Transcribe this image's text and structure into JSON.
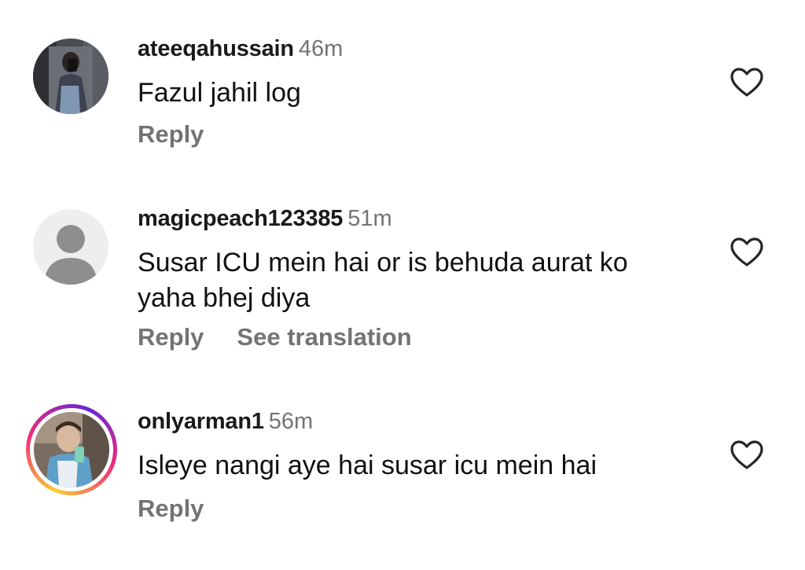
{
  "comments": [
    {
      "username": "ateeqahussain",
      "time": "46m",
      "text": "Fazul jahil log",
      "reply_label": "Reply"
    },
    {
      "username": "magicpeach123385",
      "time": "51m",
      "text": "Susar ICU mein hai or is behuda aurat ko yaha bhej diya",
      "reply_label": "Reply",
      "translate_label": "See translation"
    },
    {
      "username": "onlyarman1",
      "time": "56m",
      "text": "Isleye nangi aye hai susar icu mein hai",
      "reply_label": "Reply"
    }
  ],
  "colors": {
    "secondary_text": "#737373",
    "story_ring": "#ee2a7b",
    "default_avatar_bg": "#eeeeee",
    "default_avatar_fg": "#8e8e8e"
  },
  "icons": {
    "like": "heart-outline-icon",
    "default_avatar": "person-icon"
  }
}
